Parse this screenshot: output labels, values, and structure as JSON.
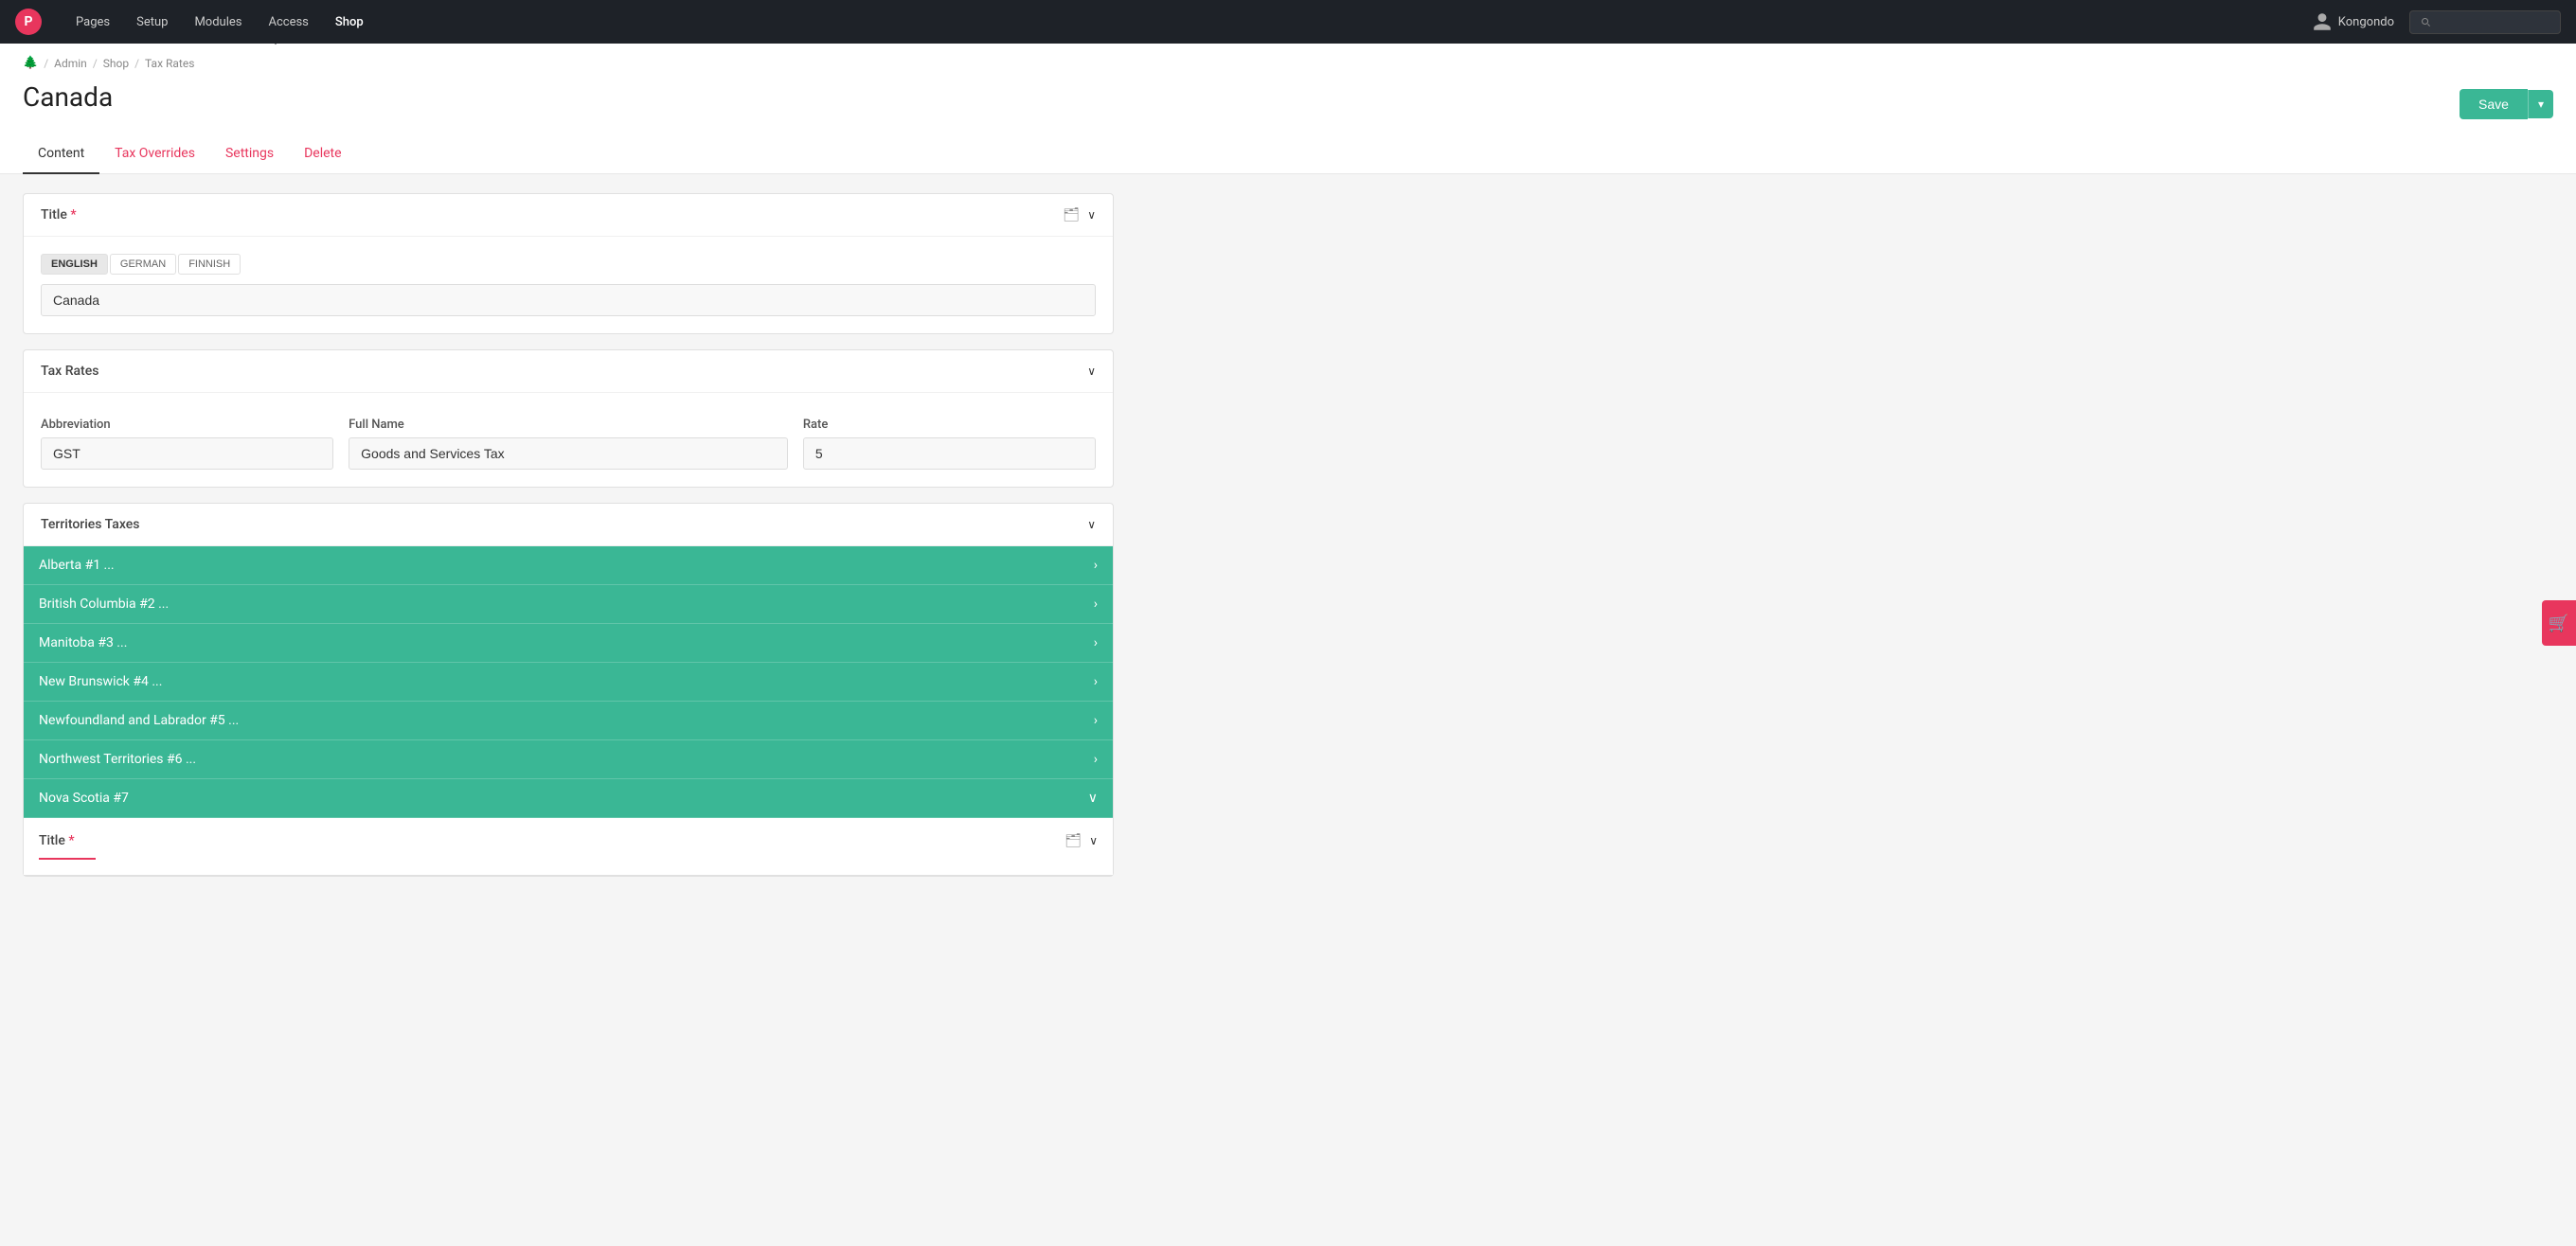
{
  "topnav": {
    "logo_letter": "P",
    "items": [
      {
        "label": "Pages",
        "id": "pages",
        "active": false
      },
      {
        "label": "Setup",
        "id": "setup",
        "active": false
      },
      {
        "label": "Modules",
        "id": "modules",
        "active": false
      },
      {
        "label": "Access",
        "id": "access",
        "active": false
      },
      {
        "label": "Shop",
        "id": "shop",
        "active": true
      }
    ],
    "user": "Kongondo",
    "search_placeholder": ""
  },
  "breadcrumb": {
    "home_icon": "🏠",
    "items": [
      "Admin",
      "Shop",
      "Tax Rates"
    ]
  },
  "page": {
    "title": "Canada"
  },
  "toolbar": {
    "save_label": "Save",
    "dropdown_label": "▾"
  },
  "tabs": [
    {
      "label": "Content",
      "id": "content",
      "active": true,
      "color": "default"
    },
    {
      "label": "Tax Overrides",
      "id": "tax-overrides",
      "active": false,
      "color": "red"
    },
    {
      "label": "Settings",
      "id": "settings",
      "active": false,
      "color": "red"
    },
    {
      "label": "Delete",
      "id": "delete",
      "active": false,
      "color": "red"
    }
  ],
  "title_section": {
    "label": "Title",
    "required": true,
    "languages": [
      "ENGLISH",
      "GERMAN",
      "FINNISH"
    ],
    "active_language": "ENGLISH",
    "value": "Canada"
  },
  "tax_rates_section": {
    "label": "Tax Rates",
    "fields": {
      "abbreviation": {
        "label": "Abbreviation",
        "value": "GST"
      },
      "full_name": {
        "label": "Full Name",
        "value": "Goods and Services Tax"
      },
      "rate": {
        "label": "Rate",
        "value": "5"
      }
    }
  },
  "territories_section": {
    "label": "Territories Taxes",
    "items": [
      {
        "label": "Alberta #1 ...",
        "expanded": false,
        "id": "alberta"
      },
      {
        "label": "British Columbia #2 ...",
        "expanded": false,
        "id": "british-columbia"
      },
      {
        "label": "Manitoba #3 ...",
        "expanded": false,
        "id": "manitoba"
      },
      {
        "label": "New Brunswick #4 ...",
        "expanded": false,
        "id": "new-brunswick"
      },
      {
        "label": "Newfoundland and Labrador #5 ...",
        "expanded": false,
        "id": "newfoundland"
      },
      {
        "label": "Northwest Territories #6 ...",
        "expanded": false,
        "id": "northwest-territories"
      },
      {
        "label": "Nova Scotia #7",
        "expanded": true,
        "id": "nova-scotia"
      }
    ]
  },
  "nova_scotia_title": {
    "label": "Title",
    "required": true
  },
  "icons": {
    "folder": "🗂",
    "chevron_down": "∨",
    "chevron_right": "›",
    "search": "🔍",
    "user": "👤",
    "cart": "🛒"
  }
}
